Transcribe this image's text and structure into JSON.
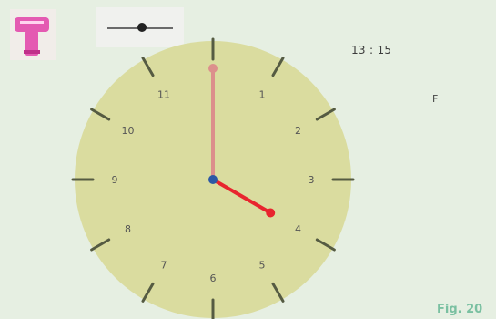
{
  "digital_time": "13 :  15",
  "unit_label": "F",
  "fig_label": "Fig. 20",
  "clock": {
    "numbers": [
      "1",
      "2",
      "3",
      "4",
      "5",
      "6",
      "7",
      "8",
      "9",
      "10",
      "11"
    ],
    "hour": 4,
    "minute": 0
  },
  "icons": {
    "app": "pink-t-icon",
    "slider_thumb": "slider-thumb"
  },
  "colors": {
    "face": "#dadc9f",
    "minute_hand": "#dc8f8c",
    "hour_hand": "#e8252e",
    "center": "#2d58a5",
    "ticks": "#555b42"
  }
}
